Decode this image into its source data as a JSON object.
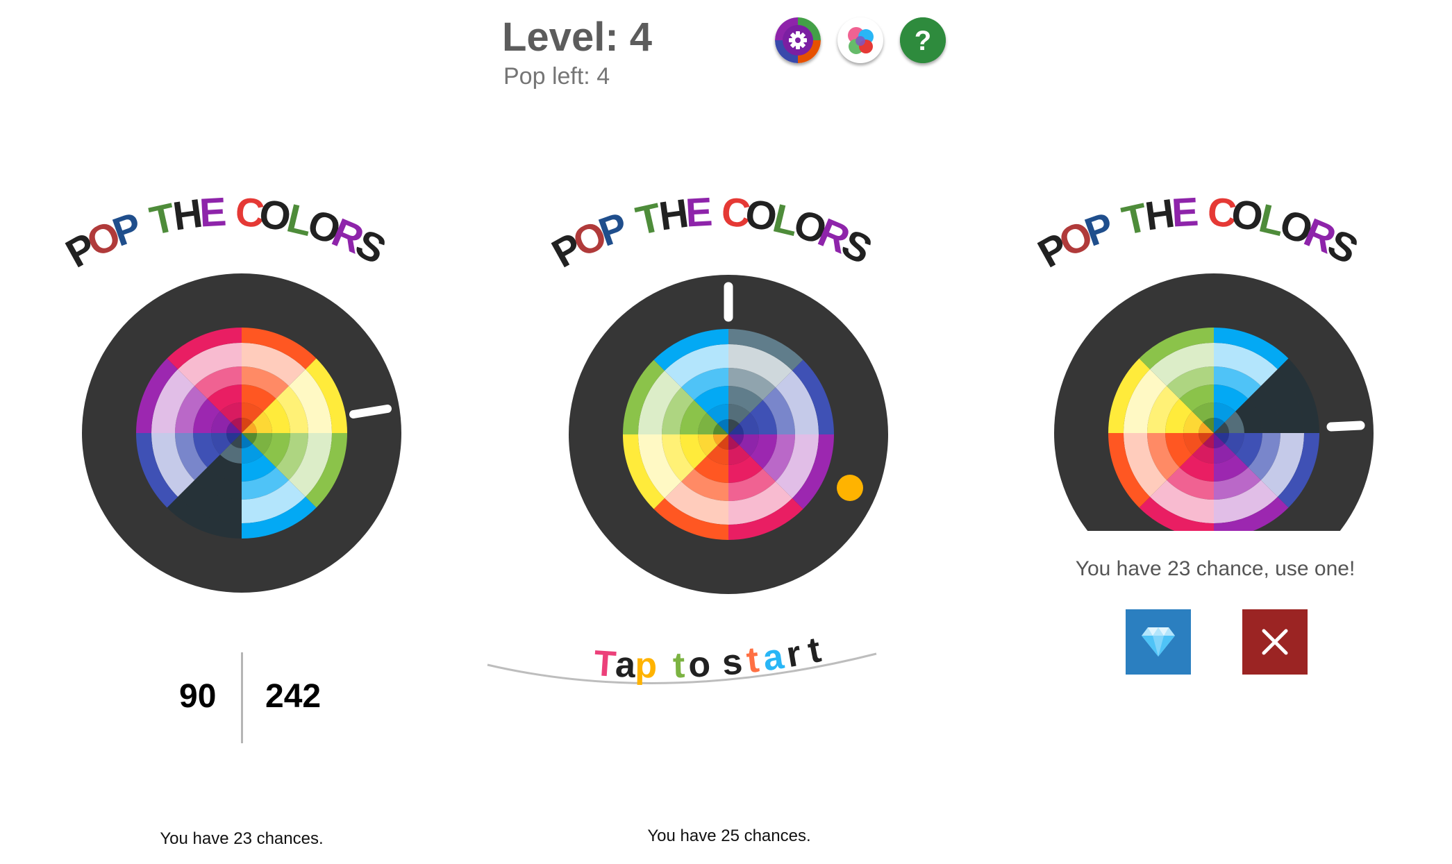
{
  "header": {
    "level_label": "Level: 4",
    "pop_left_label": "Pop left: 4",
    "buttons": {
      "settings_icon": "gear-icon",
      "game_center_icon": "game-center-icon",
      "help_icon": "question-icon",
      "help_glyph": "?"
    }
  },
  "title": {
    "letters": [
      {
        "char": "P",
        "color": "#212121"
      },
      {
        "char": "O",
        "color": "#b03a3a"
      },
      {
        "char": "P",
        "color": "#1f4e8c"
      },
      {
        "char": "T",
        "color": "#4e8c3a"
      },
      {
        "char": "H",
        "color": "#212121"
      },
      {
        "char": "E",
        "color": "#8e24aa"
      },
      {
        "char": "C",
        "color": "#e53935"
      },
      {
        "char": "O",
        "color": "#212121"
      },
      {
        "char": "L",
        "color": "#4e8c3a"
      },
      {
        "char": "O",
        "color": "#212121"
      },
      {
        "char": "R",
        "color": "#8e24aa"
      },
      {
        "char": "S",
        "color": "#212121"
      }
    ],
    "word_breaks": [
      3,
      6
    ]
  },
  "panels": {
    "left": {
      "score_left": "90",
      "score_right": "242",
      "score_left_color": "#29a3c6",
      "score_right_color": "#f06292",
      "chances_text": "You have 23 chances."
    },
    "middle": {
      "tap_letters": [
        {
          "char": "T",
          "color": "#ec407a"
        },
        {
          "char": "a",
          "color": "#212121"
        },
        {
          "char": "p",
          "color": "#ffb300"
        },
        {
          "char": "t",
          "color": "#7cb342"
        },
        {
          "char": "o",
          "color": "#212121"
        },
        {
          "char": "s",
          "color": "#212121"
        },
        {
          "char": "t",
          "color": "#ff7043"
        },
        {
          "char": "a",
          "color": "#29b6f6"
        },
        {
          "char": "r",
          "color": "#212121"
        },
        {
          "char": "t",
          "color": "#212121"
        }
      ],
      "tap_word_breaks": [
        3,
        5
      ],
      "chances_text": "You have 25 chances."
    },
    "right": {
      "prompt_text": "You have 23 chance, use one!",
      "use_button_icon": "diamond-icon",
      "use_button_color": "#2b7fc0",
      "close_button_icon": "close-icon",
      "close_button_color": "#9b2423"
    }
  },
  "wheels": {
    "ring_color": "#363636",
    "segment_shades": [
      [
        "#e91e63",
        "#f06292",
        "#f8bbd0",
        "#d81b60",
        "#ad1457"
      ],
      [
        "#ff5722",
        "#ff8a65",
        "#ffccbc",
        "#f4511e",
        "#d84315"
      ],
      [
        "#ffeb3b",
        "#fff176",
        "#fff9c4",
        "#fdd835",
        "#f9a825"
      ],
      [
        "#8bc34a",
        "#aed581",
        "#dcedc8",
        "#7cb342",
        "#558b2f"
      ],
      [
        "#03a9f4",
        "#4fc3f7",
        "#b3e5fc",
        "#039be5",
        "#0277bd"
      ],
      [
        "#607d8b",
        "#90a4ae",
        "#cfd8dc",
        "#546e7a",
        "#37474f"
      ],
      [
        "#3f51b5",
        "#7986cb",
        "#c5cae9",
        "#3949ab",
        "#283593"
      ],
      [
        "#9c27b0",
        "#ba68c8",
        "#e1bee7",
        "#8e24aa",
        "#6a1b9a"
      ]
    ],
    "dark_wedge_color": "#263238",
    "ball_color": "#ffb300",
    "left_order": [
      1,
      2,
      3,
      4,
      5,
      6,
      7,
      0
    ],
    "middle_order": [
      5,
      6,
      7,
      0,
      1,
      2,
      3,
      4
    ],
    "right_order": [
      4,
      5,
      6,
      7,
      0,
      1,
      2,
      3
    ]
  }
}
